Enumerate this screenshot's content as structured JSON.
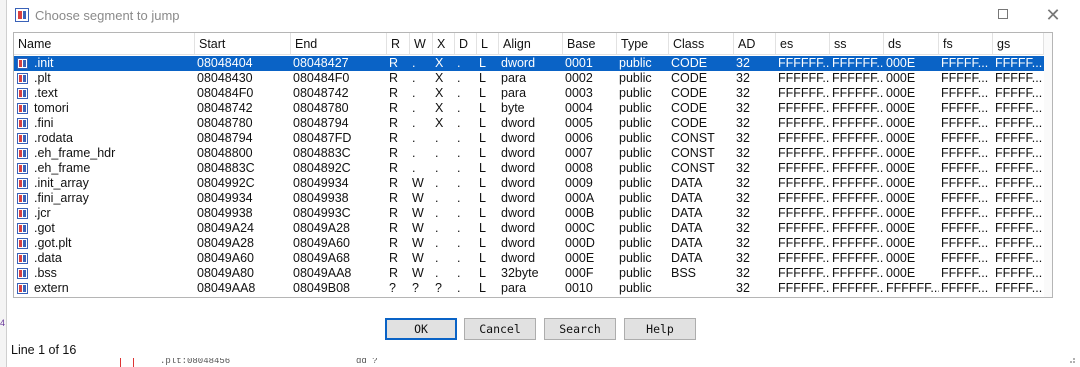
{
  "window": {
    "title": "Choose segment to jump"
  },
  "columns": [
    "Name",
    "Start",
    "End",
    "R",
    "W",
    "X",
    "D",
    "L",
    "Align",
    "Base",
    "Type",
    "Class",
    "AD",
    "es",
    "ss",
    "ds",
    "fs",
    "gs"
  ],
  "rows": [
    {
      "name": ".init",
      "start": "08048404",
      "end": "08048427",
      "r": "R",
      "w": ".",
      "x": "X",
      "d": ".",
      "l": "L",
      "align": "dword",
      "base": "0001",
      "type": "public",
      "cls": "CODE",
      "ad": "32",
      "es": "FFFFFF...",
      "ss": "FFFFFF...",
      "ds": "000E",
      "fs": "FFFFF...",
      "gs": "FFFFF..."
    },
    {
      "name": ".plt",
      "start": "08048430",
      "end": "080484F0",
      "r": "R",
      "w": ".",
      "x": "X",
      "d": ".",
      "l": "L",
      "align": "para",
      "base": "0002",
      "type": "public",
      "cls": "CODE",
      "ad": "32",
      "es": "FFFFFF...",
      "ss": "FFFFFF...",
      "ds": "000E",
      "fs": "FFFFF...",
      "gs": "FFFFF..."
    },
    {
      "name": ".text",
      "start": "080484F0",
      "end": "08048742",
      "r": "R",
      "w": ".",
      "x": "X",
      "d": ".",
      "l": "L",
      "align": "para",
      "base": "0003",
      "type": "public",
      "cls": "CODE",
      "ad": "32",
      "es": "FFFFFF...",
      "ss": "FFFFFF...",
      "ds": "000E",
      "fs": "FFFFF...",
      "gs": "FFFFF..."
    },
    {
      "name": "tomori",
      "start": "08048742",
      "end": "08048780",
      "r": "R",
      "w": ".",
      "x": "X",
      "d": ".",
      "l": "L",
      "align": "byte",
      "base": "0004",
      "type": "public",
      "cls": "CODE",
      "ad": "32",
      "es": "FFFFFF...",
      "ss": "FFFFFF...",
      "ds": "000E",
      "fs": "FFFFF...",
      "gs": "FFFFF..."
    },
    {
      "name": ".fini",
      "start": "08048780",
      "end": "08048794",
      "r": "R",
      "w": ".",
      "x": "X",
      "d": ".",
      "l": "L",
      "align": "dword",
      "base": "0005",
      "type": "public",
      "cls": "CODE",
      "ad": "32",
      "es": "FFFFFF...",
      "ss": "FFFFFF...",
      "ds": "000E",
      "fs": "FFFFF...",
      "gs": "FFFFF..."
    },
    {
      "name": ".rodata",
      "start": "08048794",
      "end": "080487FD",
      "r": "R",
      "w": ".",
      "x": ".",
      "d": ".",
      "l": "L",
      "align": "dword",
      "base": "0006",
      "type": "public",
      "cls": "CONST",
      "ad": "32",
      "es": "FFFFFF...",
      "ss": "FFFFFF...",
      "ds": "000E",
      "fs": "FFFFF...",
      "gs": "FFFFF..."
    },
    {
      "name": ".eh_frame_hdr",
      "start": "08048800",
      "end": "0804883C",
      "r": "R",
      "w": ".",
      "x": ".",
      "d": ".",
      "l": "L",
      "align": "dword",
      "base": "0007",
      "type": "public",
      "cls": "CONST",
      "ad": "32",
      "es": "FFFFFF...",
      "ss": "FFFFFF...",
      "ds": "000E",
      "fs": "FFFFF...",
      "gs": "FFFFF..."
    },
    {
      "name": ".eh_frame",
      "start": "0804883C",
      "end": "0804892C",
      "r": "R",
      "w": ".",
      "x": ".",
      "d": ".",
      "l": "L",
      "align": "dword",
      "base": "0008",
      "type": "public",
      "cls": "CONST",
      "ad": "32",
      "es": "FFFFFF...",
      "ss": "FFFFFF...",
      "ds": "000E",
      "fs": "FFFFF...",
      "gs": "FFFFF..."
    },
    {
      "name": ".init_array",
      "start": "0804992C",
      "end": "08049934",
      "r": "R",
      "w": "W",
      "x": ".",
      "d": ".",
      "l": "L",
      "align": "dword",
      "base": "0009",
      "type": "public",
      "cls": "DATA",
      "ad": "32",
      "es": "FFFFFF...",
      "ss": "FFFFFF...",
      "ds": "000E",
      "fs": "FFFFF...",
      "gs": "FFFFF..."
    },
    {
      "name": ".fini_array",
      "start": "08049934",
      "end": "08049938",
      "r": "R",
      "w": "W",
      "x": ".",
      "d": ".",
      "l": "L",
      "align": "dword",
      "base": "000A",
      "type": "public",
      "cls": "DATA",
      "ad": "32",
      "es": "FFFFFF...",
      "ss": "FFFFFF...",
      "ds": "000E",
      "fs": "FFFFF...",
      "gs": "FFFFF..."
    },
    {
      "name": ".jcr",
      "start": "08049938",
      "end": "0804993C",
      "r": "R",
      "w": "W",
      "x": ".",
      "d": ".",
      "l": "L",
      "align": "dword",
      "base": "000B",
      "type": "public",
      "cls": "DATA",
      "ad": "32",
      "es": "FFFFFF...",
      "ss": "FFFFFF...",
      "ds": "000E",
      "fs": "FFFFF...",
      "gs": "FFFFF..."
    },
    {
      "name": ".got",
      "start": "08049A24",
      "end": "08049A28",
      "r": "R",
      "w": "W",
      "x": ".",
      "d": ".",
      "l": "L",
      "align": "dword",
      "base": "000C",
      "type": "public",
      "cls": "DATA",
      "ad": "32",
      "es": "FFFFFF...",
      "ss": "FFFFFF...",
      "ds": "000E",
      "fs": "FFFFF...",
      "gs": "FFFFF..."
    },
    {
      "name": ".got.plt",
      "start": "08049A28",
      "end": "08049A60",
      "r": "R",
      "w": "W",
      "x": ".",
      "d": ".",
      "l": "L",
      "align": "dword",
      "base": "000D",
      "type": "public",
      "cls": "DATA",
      "ad": "32",
      "es": "FFFFFF...",
      "ss": "FFFFFF...",
      "ds": "000E",
      "fs": "FFFFF...",
      "gs": "FFFFF..."
    },
    {
      "name": ".data",
      "start": "08049A60",
      "end": "08049A68",
      "r": "R",
      "w": "W",
      "x": ".",
      "d": ".",
      "l": "L",
      "align": "dword",
      "base": "000E",
      "type": "public",
      "cls": "DATA",
      "ad": "32",
      "es": "FFFFFF...",
      "ss": "FFFFFF...",
      "ds": "000E",
      "fs": "FFFFF...",
      "gs": "FFFFF..."
    },
    {
      "name": ".bss",
      "start": "08049A80",
      "end": "08049AA8",
      "r": "R",
      "w": "W",
      "x": ".",
      "d": ".",
      "l": "L",
      "align": "32byte",
      "base": "000F",
      "type": "public",
      "cls": "BSS",
      "ad": "32",
      "es": "FFFFFF...",
      "ss": "FFFFFF...",
      "ds": "000E",
      "fs": "FFFFF...",
      "gs": "FFFFF..."
    },
    {
      "name": "extern",
      "start": "08049AA8",
      "end": "08049B08",
      "r": "?",
      "w": "?",
      "x": "?",
      "d": ".",
      "l": "L",
      "align": "para",
      "base": "0010",
      "type": "public",
      "cls": "",
      "ad": "32",
      "es": "FFFFFF...",
      "ss": "FFFFFF...",
      "ds": "FFFFFF...",
      "fs": "FFFFF...",
      "gs": "FFFFF..."
    }
  ],
  "selected_index": 0,
  "buttons": {
    "ok": "OK",
    "cancel": "Cancel",
    "search": "Search",
    "help": "Help"
  },
  "status": {
    "line": "Line 1 of 16"
  },
  "background": {
    "left_mark": "4",
    "code_label": ".plt:08048456",
    "code_operand": "dd ?"
  },
  "colors": {
    "selection": "#0a63c6",
    "selection_text": "#ffffff"
  }
}
